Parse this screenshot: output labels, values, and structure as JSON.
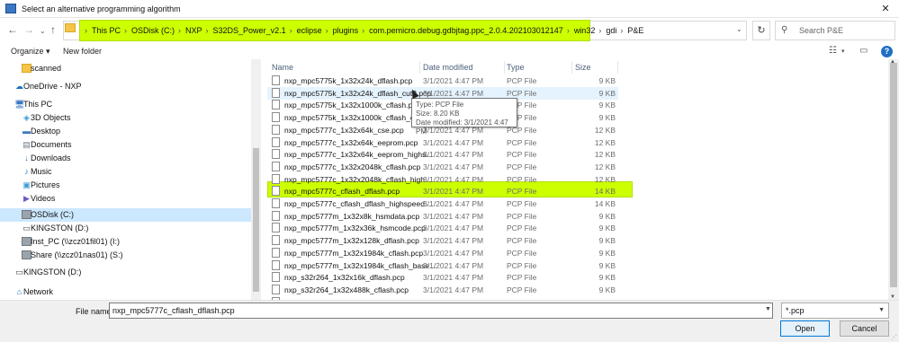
{
  "window": {
    "title": "Select an alternative programming algorithm",
    "close": "✕"
  },
  "address": {
    "breadcrumbs": [
      "This PC",
      "OSDisk (C:)",
      "NXP",
      "S32DS_Power_v2.1",
      "eclipse",
      "plugins",
      "com.pemicro.debug.gdbjtag.ppc_2.0.4.202103012147",
      "win32",
      "gdi",
      "P&E"
    ],
    "separator": "›",
    "search_placeholder": "Search P&E"
  },
  "toolbar": {
    "organize": "Organize ▾",
    "new_folder": "New folder"
  },
  "nav": {
    "items": [
      {
        "label": "scanned",
        "icon": "folder-icon"
      },
      {
        "label": "OneDrive - NXP",
        "icon": "cloud-icon"
      },
      {
        "label": "This PC",
        "icon": "computer-icon"
      },
      {
        "label": "3D Objects",
        "icon": "cube-icon"
      },
      {
        "label": "Desktop",
        "icon": "desktop-icon"
      },
      {
        "label": "Documents",
        "icon": "documents-icon"
      },
      {
        "label": "Downloads",
        "icon": "download-icon"
      },
      {
        "label": "Music",
        "icon": "music-icon"
      },
      {
        "label": "Pictures",
        "icon": "pictures-icon"
      },
      {
        "label": "Videos",
        "icon": "videos-icon"
      },
      {
        "label": "OSDisk (C:)",
        "icon": "drive-icon"
      },
      {
        "label": "KINGSTON (D:)",
        "icon": "usb-drive-icon"
      },
      {
        "label": "Inst_PC (\\\\zcz01fil01) (I:)",
        "icon": "network-drive-icon"
      },
      {
        "label": "Share (\\\\zcz01nas01) (S:)",
        "icon": "network-drive-icon"
      },
      {
        "label": "KINGSTON (D:)",
        "icon": "usb-drive-icon"
      },
      {
        "label": "Network",
        "icon": "network-icon"
      }
    ]
  },
  "columns": {
    "name": "Name",
    "date": "Date modified",
    "type": "Type",
    "size": "Size"
  },
  "files": [
    {
      "name": "nxp_mpc5775k_1x32x24k_dflash.pcp",
      "date": "3/1/2021 4:47 PM",
      "type": "PCP File",
      "size": "9 KB"
    },
    {
      "name": "nxp_mpc5775k_1x32x24k_dflash_cut2.pcp",
      "date": "3/1/2021 4:47 PM",
      "type": "PCP File",
      "size": "9 KB"
    },
    {
      "name": "nxp_mpc5775k_1x32x1000k_cflash.pcp",
      "date": "3/1/2021 4:47 PM",
      "type": "PCP File",
      "size": "9 KB"
    },
    {
      "name": "nxp_mpc5775k_1x32x1000k_cflash_cut2...",
      "date": "3/1/2021 4:47 PM",
      "type": "PCP File",
      "size": "9 KB"
    },
    {
      "name": "nxp_mpc5777c_1x32x64k_cse.pcp",
      "date": "3/1/2021 4:47 PM",
      "type": "PCP File",
      "size": "12 KB"
    },
    {
      "name": "nxp_mpc5777c_1x32x64k_eeprom.pcp",
      "date": "3/1/2021 4:47 PM",
      "type": "PCP File",
      "size": "12 KB"
    },
    {
      "name": "nxp_mpc5777c_1x32x64k_eeprom_highs...",
      "date": "3/1/2021 4:47 PM",
      "type": "PCP File",
      "size": "12 KB"
    },
    {
      "name": "nxp_mpc5777c_1x32x2048k_cflash.pcp",
      "date": "3/1/2021 4:47 PM",
      "type": "PCP File",
      "size": "12 KB"
    },
    {
      "name": "nxp_mpc5777c_1x32x2048k_cflash_high...",
      "date": "3/1/2021 4:47 PM",
      "type": "PCP File",
      "size": "12 KB"
    },
    {
      "name": "nxp_mpc5777c_cflash_dflash.pcp",
      "date": "3/1/2021 4:47 PM",
      "type": "PCP File",
      "size": "14 KB"
    },
    {
      "name": "nxp_mpc5777c_cflash_dflash_highspeed....",
      "date": "3/1/2021 4:47 PM",
      "type": "PCP File",
      "size": "14 KB"
    },
    {
      "name": "nxp_mpc5777m_1x32x8k_hsmdata.pcp",
      "date": "3/1/2021 4:47 PM",
      "type": "PCP File",
      "size": "9 KB"
    },
    {
      "name": "nxp_mpc5777m_1x32x36k_hsmcode.pcp",
      "date": "3/1/2021 4:47 PM",
      "type": "PCP File",
      "size": "9 KB"
    },
    {
      "name": "nxp_mpc5777m_1x32x128k_dflash.pcp",
      "date": "3/1/2021 4:47 PM",
      "type": "PCP File",
      "size": "9 KB"
    },
    {
      "name": "nxp_mpc5777m_1x32x1984k_cflash.pcp",
      "date": "3/1/2021 4:47 PM",
      "type": "PCP File",
      "size": "9 KB"
    },
    {
      "name": "nxp_mpc5777m_1x32x1984k_cflash_base...",
      "date": "3/1/2021 4:47 PM",
      "type": "PCP File",
      "size": "9 KB"
    },
    {
      "name": "nxp_s32r264_1x32x16k_dflash.pcp",
      "date": "3/1/2021 4:47 PM",
      "type": "PCP File",
      "size": "9 KB"
    },
    {
      "name": "nxp_s32r264_1x32x488k_cflash.pcp",
      "date": "3/1/2021 4:47 PM",
      "type": "PCP File",
      "size": "9 KB"
    },
    {
      "name": "nxp_s32r274_1x32x16k_dflash.pcp",
      "date": "3/1/2021 4:47 PM",
      "type": "PCP File",
      "size": "9 KB"
    }
  ],
  "tooltip": {
    "type": "Type: PCP File",
    "size": "Size: 8.20 KB",
    "date": "Date modified: 3/1/2021 4:47 PM"
  },
  "footer": {
    "file_name_label": "File name:",
    "file_name_value": "nxp_mpc5777c_cflash_dflash.pcp",
    "filter": "*.pcp",
    "open": "Open",
    "cancel": "Cancel"
  },
  "colors": {
    "highlight": "#ccff00",
    "selection": "#cce8ff",
    "hover": "#e5f3ff"
  }
}
